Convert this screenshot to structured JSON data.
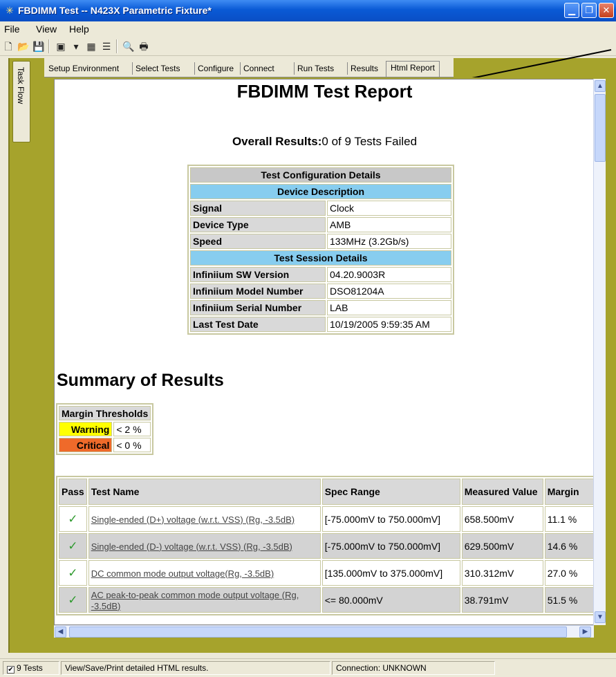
{
  "window": {
    "title": "FBDIMM Test -- N423X Parametric Fixture*"
  },
  "menu": [
    "File",
    "View",
    "Help"
  ],
  "toolbar": {
    "buttons": [
      "new-icon",
      "open-icon",
      "save-icon",
      "properties-icon",
      "filter-icon",
      "tests-icon",
      "list-icon",
      "print-preview-icon",
      "print-icon"
    ]
  },
  "taskflow": {
    "label": "Task Flow"
  },
  "tabs": [
    {
      "label": "Setup Environment"
    },
    {
      "label": "Select Tests"
    },
    {
      "label": "Configure"
    },
    {
      "label": "Connect"
    },
    {
      "label": "Run Tests"
    },
    {
      "label": "Results"
    },
    {
      "label": "Html Report",
      "active": true
    }
  ],
  "report": {
    "title": "FBDIMM Test Report",
    "overall_label": "Overall Results:",
    "overall_value": "0 of 9 Tests Failed",
    "config": {
      "header": "Test Configuration Details",
      "device_header": "Device Description",
      "device_rows": [
        {
          "label": "Signal",
          "value": "Clock"
        },
        {
          "label": "Device Type",
          "value": "AMB"
        },
        {
          "label": "Speed",
          "value": "133MHz (3.2Gb/s)"
        }
      ],
      "session_header": "Test Session Details",
      "session_rows": [
        {
          "label": "Infiniium SW Version",
          "value": "04.20.9003R"
        },
        {
          "label": "Infiniium Model Number",
          "value": "DSO81204A"
        },
        {
          "label": "Infiniium Serial Number",
          "value": "LAB"
        },
        {
          "label": "Last Test Date",
          "value": "10/19/2005 9:59:35 AM"
        }
      ]
    },
    "summary_title": "Summary of Results",
    "margin": {
      "header": "Margin Thresholds",
      "warning_label": "Warning",
      "warning_value": "< 2 %",
      "critical_label": "Critical",
      "critical_value": "< 0 %",
      "warning_color": "#ffff00",
      "critical_color": "#ef6a2a"
    },
    "results": {
      "headers": [
        "Pass",
        "Test Name",
        "Spec Range",
        "Measured Value",
        "Margin"
      ],
      "rows": [
        {
          "pass": "✓",
          "name": "Single-ended (D+) voltage (w.r.t. VSS) (Rg, -3.5dB)",
          "spec": "[-75.000mV to 750.000mV]",
          "measured": "658.500mV",
          "margin": "11.1 %"
        },
        {
          "pass": "✓",
          "name": "Single-ended (D-) voltage (w.r.t. VSS) (Rg, -3.5dB)",
          "spec": "[-75.000mV to 750.000mV]",
          "measured": "629.500mV",
          "margin": "14.6 %"
        },
        {
          "pass": "✓",
          "name": "DC common mode output voltage(Rg, -3.5dB)",
          "spec": "[135.000mV to 375.000mV]",
          "measured": "310.312mV",
          "margin": "27.0 %"
        },
        {
          "pass": "✓",
          "name": "AC peak-to-peak common mode output voltage (Rg, -3.5dB)",
          "spec": "<= 80.000mV",
          "measured": "38.791mV",
          "margin": "51.5 %"
        }
      ]
    }
  },
  "status": {
    "tests_checkbox": "9 Tests",
    "message": "View/Save/Print detailed HTML results.",
    "connection": "Connection: UNKNOWN"
  }
}
